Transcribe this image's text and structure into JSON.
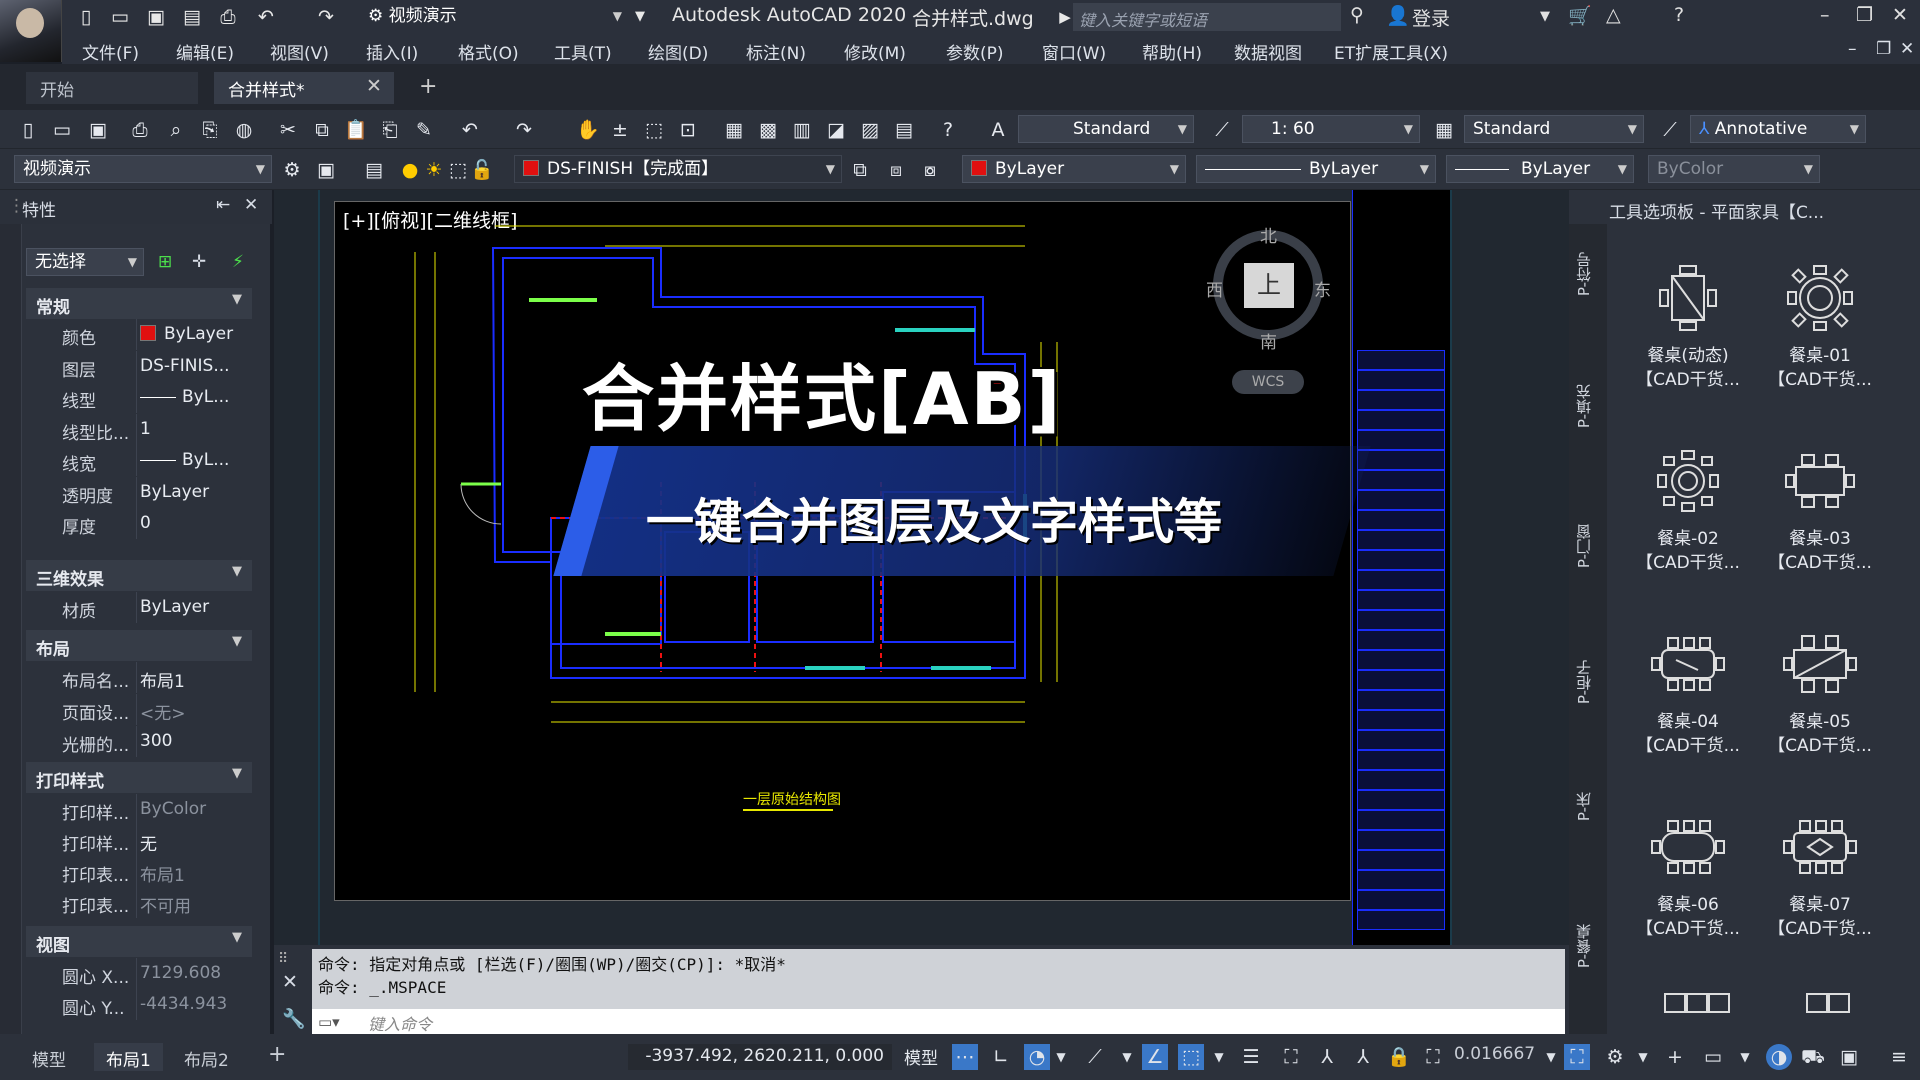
{
  "titlebar": {
    "workspace": "视频演示",
    "app_title": "Autodesk AutoCAD 2020",
    "file_title": "合并样式.dwg",
    "search_placeholder": "键入关键字或短语",
    "login": "登录"
  },
  "menu": [
    "文件(F)",
    "编辑(E)",
    "视图(V)",
    "插入(I)",
    "格式(O)",
    "工具(T)",
    "绘图(D)",
    "标注(N)",
    "修改(M)",
    "参数(P)",
    "窗口(W)",
    "帮助(H)",
    "数据视图",
    "ET扩展工具(X)"
  ],
  "tabs": {
    "start": "开始",
    "file": "合并样式*"
  },
  "toolbar1": {
    "text_style": "Standard",
    "dim_scale": "1: 60",
    "table_style": "Standard",
    "annotative": "Annotative"
  },
  "toolbar2": {
    "workspace": "视频演示",
    "layer": "DS-FINISH【完成面】",
    "color": "ByLayer",
    "linetype": "ByLayer",
    "lineweight": "ByLayer",
    "plotstyle": "ByColor"
  },
  "props": {
    "title": "特性",
    "selection": "无选择",
    "sections": {
      "general": "常规",
      "effects3d": "三维效果",
      "layout": "布局",
      "plotstyle": "打印样式",
      "view": "视图"
    },
    "general": [
      {
        "k": "颜色",
        "v": "ByLayer"
      },
      {
        "k": "图层",
        "v": "DS-FINIS..."
      },
      {
        "k": "线型",
        "v": "ByL..."
      },
      {
        "k": "线型比...",
        "v": "1"
      },
      {
        "k": "线宽",
        "v": "ByL..."
      },
      {
        "k": "透明度",
        "v": "ByLayer"
      },
      {
        "k": "厚度",
        "v": "0"
      }
    ],
    "effects3d": [
      {
        "k": "材质",
        "v": "ByLayer"
      }
    ],
    "layout": [
      {
        "k": "布局名...",
        "v": "布局1"
      },
      {
        "k": "页面设...",
        "v": "<无>"
      },
      {
        "k": "光栅的...",
        "v": "300"
      }
    ],
    "plotstyle": [
      {
        "k": "打印样...",
        "v": "ByColor"
      },
      {
        "k": "打印样...",
        "v": "无"
      },
      {
        "k": "打印表...",
        "v": "布局1"
      },
      {
        "k": "打印表...",
        "v": "不可用"
      }
    ],
    "view": [
      {
        "k": "圆心 X...",
        "v": "7129.608"
      },
      {
        "k": "圆心 Y...",
        "v": "-4434.943"
      }
    ]
  },
  "viewport": {
    "label": "[+][俯视][二维线框]",
    "compass": {
      "n": "北",
      "s": "南",
      "e": "东",
      "w": "西",
      "cube": "上",
      "wcs": "WCS"
    },
    "drawing_caption": "一层原始结构图"
  },
  "banner": {
    "title": "合并样式[AB]",
    "subtitle": "一键合并图层及文字样式等"
  },
  "command": {
    "line1": "命令: 指定对角点或 [栏选(F)/圈围(WP)/圈交(CP)]: *取消*",
    "line2": "命令: _.MSPACE",
    "placeholder": "键入命令"
  },
  "palette": {
    "title": "工具选项板 - 平面家具【C...",
    "side_tabs": [
      "P-符号",
      "P-填充",
      "P-门窗",
      "P-柜子",
      "P-床",
      "P-餐桌"
    ],
    "items": [
      {
        "name": "餐桌(动态)",
        "sub": "【CAD干货..."
      },
      {
        "name": "餐桌-01",
        "sub": "【CAD干货..."
      },
      {
        "name": "餐桌-02",
        "sub": "【CAD干货..."
      },
      {
        "name": "餐桌-03",
        "sub": "【CAD干货..."
      },
      {
        "name": "餐桌-04",
        "sub": "【CAD干货..."
      },
      {
        "name": "餐桌-05",
        "sub": "【CAD干货..."
      },
      {
        "name": "餐桌-06",
        "sub": "【CAD干货..."
      },
      {
        "name": "餐桌-07",
        "sub": "【CAD干货..."
      }
    ]
  },
  "status": {
    "layout_tabs": [
      "模型",
      "布局1",
      "布局2"
    ],
    "coords": "-3937.492, 2620.211, 0.000",
    "model": "模型",
    "scale": "0.016667"
  },
  "colors": {
    "accent": "#2c5de8",
    "bylayer_red": "#e01010",
    "drawing_blue": "#1a2dff",
    "drawing_yellow": "#e8e800"
  }
}
